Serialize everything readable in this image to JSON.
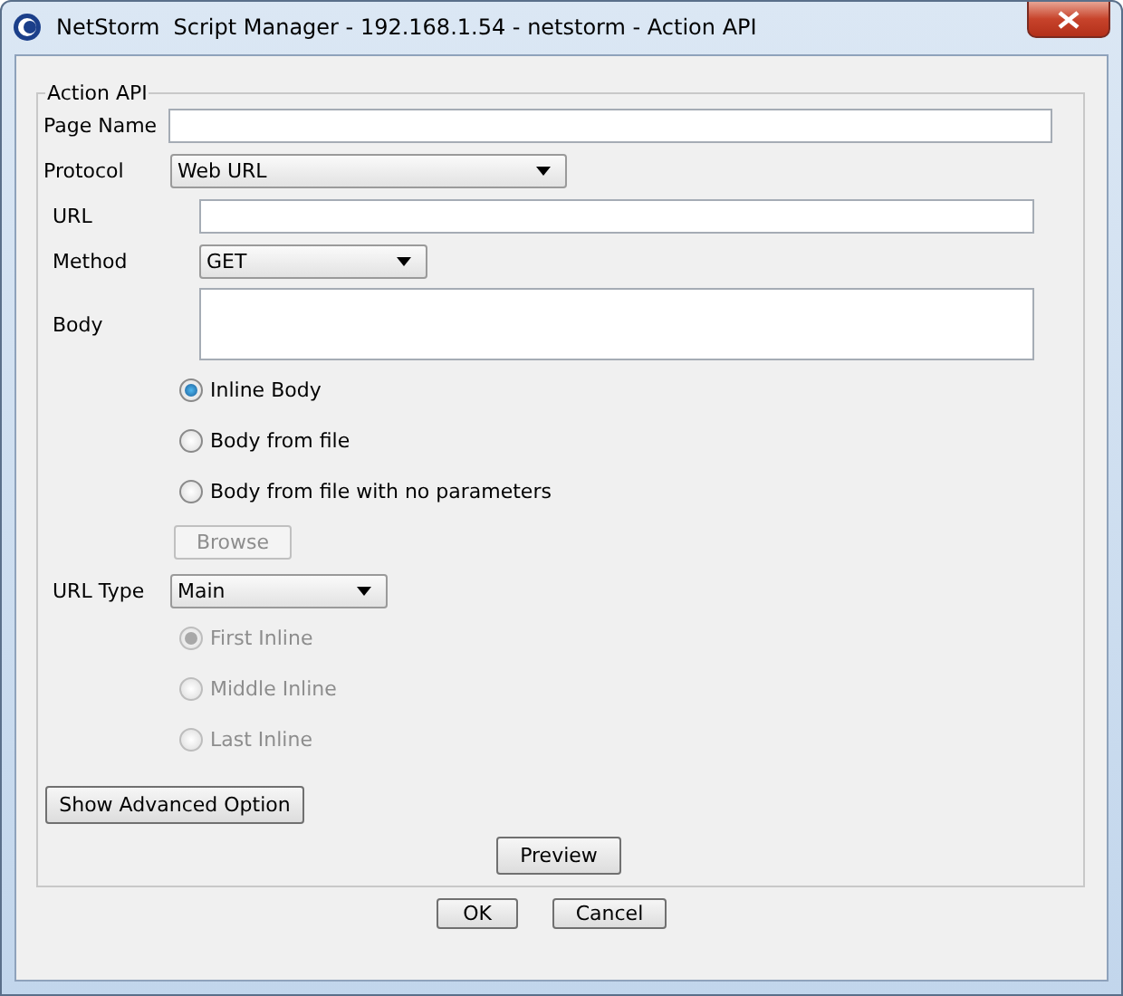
{
  "window": {
    "title": "NetStorm  Script Manager - 192.168.1.54 - netstorm - Action API"
  },
  "group_title": "Action API",
  "page_name": {
    "label": "Page Name"
  },
  "protocol": {
    "label": "Protocol",
    "value": "Web URL"
  },
  "url": {
    "label": "URL"
  },
  "method": {
    "label": "Method",
    "value": "GET"
  },
  "body": {
    "label": "Body"
  },
  "body_source": [
    {
      "label": "Inline Body",
      "selected": true,
      "disabled": false
    },
    {
      "label": "Body from file",
      "selected": false,
      "disabled": false
    },
    {
      "label": "Body from file with no parameters",
      "selected": false,
      "disabled": false
    }
  ],
  "browse_button": {
    "label": "Browse",
    "disabled": true
  },
  "url_type": {
    "label": "URL Type",
    "value": "Main"
  },
  "inline_position": [
    {
      "label": "First Inline",
      "selected": true,
      "disabled": true
    },
    {
      "label": "Middle Inline",
      "selected": false,
      "disabled": true
    },
    {
      "label": "Last Inline",
      "selected": false,
      "disabled": true
    }
  ],
  "advanced_button": {
    "label": "Show Advanced Option"
  },
  "preview_button": {
    "label": "Preview"
  },
  "dialog_buttons": [
    "OK",
    "Cancel"
  ]
}
